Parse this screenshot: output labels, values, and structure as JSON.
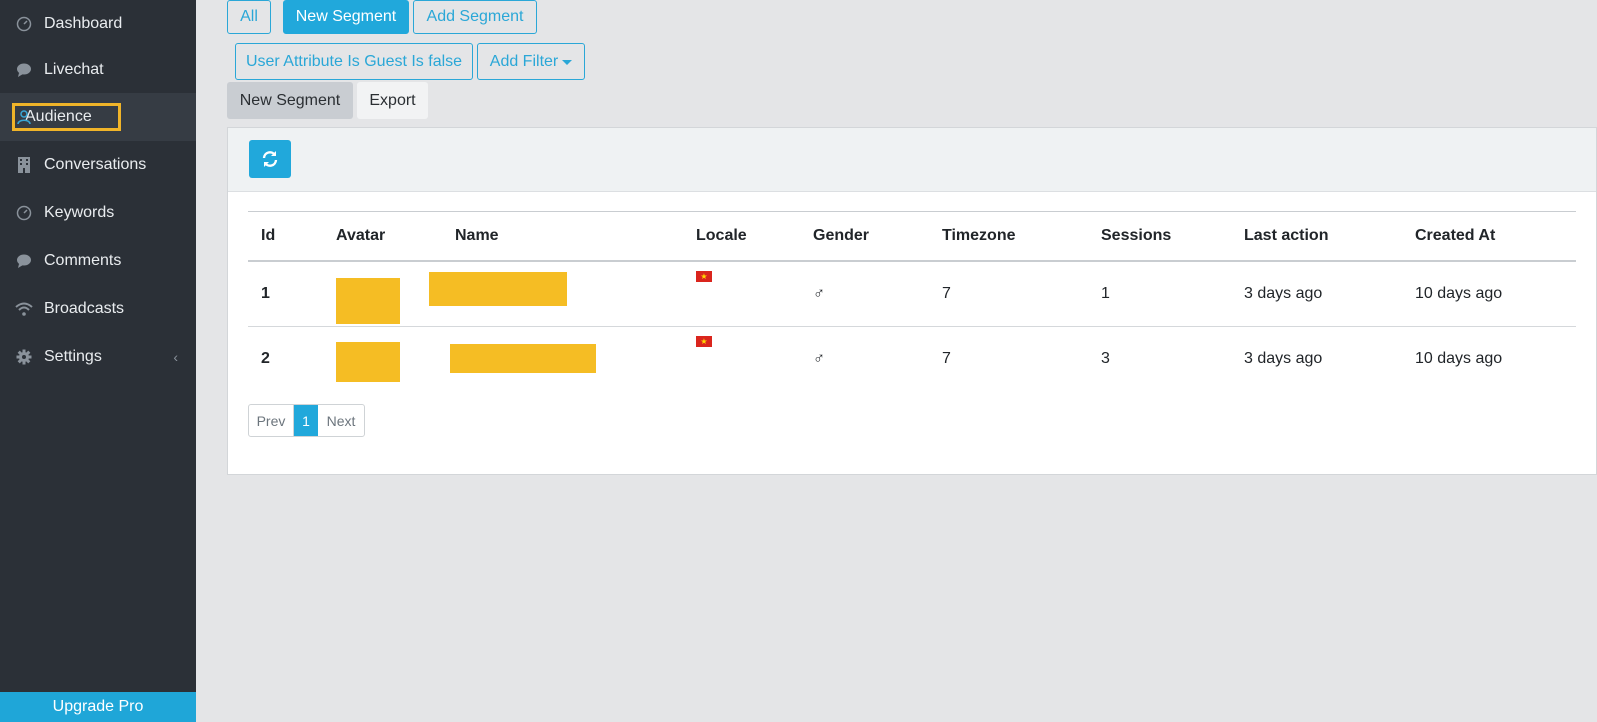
{
  "sidebar": {
    "items": [
      {
        "label": "Dashboard",
        "icon": "speedometer-icon"
      },
      {
        "label": "Livechat",
        "icon": "chat-bubble-icon"
      },
      {
        "label": "Audience",
        "icon": "user-icon"
      },
      {
        "label": "Conversations",
        "icon": "building-icon"
      },
      {
        "label": "Keywords",
        "icon": "speedometer-icon"
      },
      {
        "label": "Comments",
        "icon": "chat-bubble-icon"
      },
      {
        "label": "Broadcasts",
        "icon": "wifi-icon"
      },
      {
        "label": "Settings",
        "icon": "gear-icon"
      }
    ],
    "active": "Audience",
    "upgrade_label": "Upgrade Pro"
  },
  "segments": {
    "all_label": "All",
    "new_segment_label": "New Segment",
    "add_segment_label": "Add Segment"
  },
  "filters": {
    "active_filter_label": "User Attribute Is Guest Is false",
    "add_filter_label": "Add Filter"
  },
  "actions": {
    "new_segment_label": "New Segment",
    "export_label": "Export"
  },
  "table": {
    "columns": [
      "Id",
      "Avatar",
      "Name",
      "Locale",
      "Gender",
      "Timezone",
      "Sessions",
      "Last action",
      "Created At"
    ],
    "rows": [
      {
        "id": "1",
        "timezone": "7",
        "sessions": "1",
        "last_action": "3 days ago",
        "created_at": "10 days ago",
        "gender": "♂"
      },
      {
        "id": "2",
        "timezone": "7",
        "sessions": "3",
        "last_action": "3 days ago",
        "created_at": "10 days ago",
        "gender": "♂"
      }
    ]
  },
  "pagination": {
    "prev_label": "Prev",
    "current_page": "1",
    "next_label": "Next"
  },
  "colors": {
    "accent": "#21a8db",
    "sidebar_bg": "#2b3037",
    "highlight_border": "#f0b429",
    "redaction": "#f5bd24"
  }
}
